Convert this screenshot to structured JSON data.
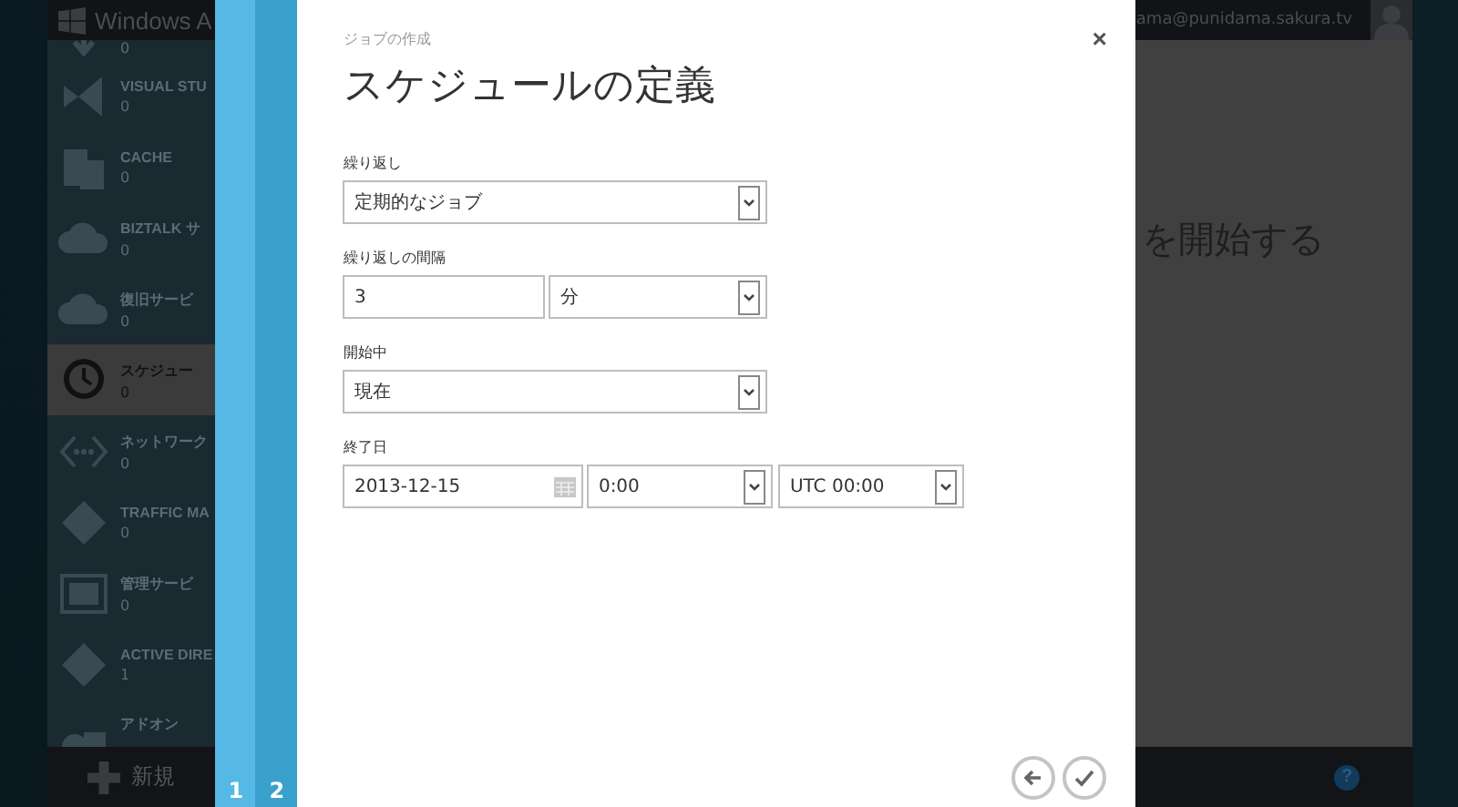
{
  "app": {
    "title": "Windows A",
    "account": "ama@punidama.sakura.tv"
  },
  "sidebar": {
    "items": [
      {
        "count": "0",
        "selected": false
      },
      {
        "name": "VISUAL STU",
        "count": "0",
        "selected": false
      },
      {
        "name": "CACHE",
        "count": "0",
        "selected": false
      },
      {
        "name": "BIZTALK サ",
        "count": "0",
        "selected": false
      },
      {
        "name": "復旧サービ",
        "count": "0",
        "selected": false
      },
      {
        "name": "スケジュー",
        "count": "0",
        "selected": true
      },
      {
        "name": "ネットワーク",
        "count": "0",
        "selected": false
      },
      {
        "name": "TRAFFIC MA",
        "count": "0",
        "selected": false
      },
      {
        "name": "管理サービ",
        "count": "0",
        "selected": false
      },
      {
        "name": "ACTIVE DIRE",
        "count": "1",
        "selected": false
      },
      {
        "name": "アドオン",
        "selected": false
      }
    ],
    "new_button": "新規"
  },
  "content": {
    "heading": "を開始する"
  },
  "help_button": "?",
  "wizard": {
    "steps": [
      {
        "label": "1",
        "selected": false
      },
      {
        "label": "2",
        "selected": true
      }
    ],
    "subtitle": "ジョブの作成",
    "title": "スケジュールの定義",
    "close": "×",
    "fields": [
      {
        "label": "繰り返し",
        "controls": [
          {
            "kind": "select",
            "value": "定期的なジョブ"
          }
        ]
      },
      {
        "label": "繰り返しの間隔",
        "controls": [
          {
            "kind": "text",
            "value": "3"
          },
          {
            "kind": "select",
            "value": "分"
          }
        ]
      },
      {
        "label": "開始中",
        "controls": [
          {
            "kind": "select",
            "value": "現在"
          }
        ]
      },
      {
        "label": "終了日",
        "controls": [
          {
            "kind": "date",
            "value": "2013-12-15"
          },
          {
            "kind": "select",
            "value": "0:00"
          },
          {
            "kind": "select",
            "value": "UTC 00:00"
          }
        ]
      }
    ]
  }
}
